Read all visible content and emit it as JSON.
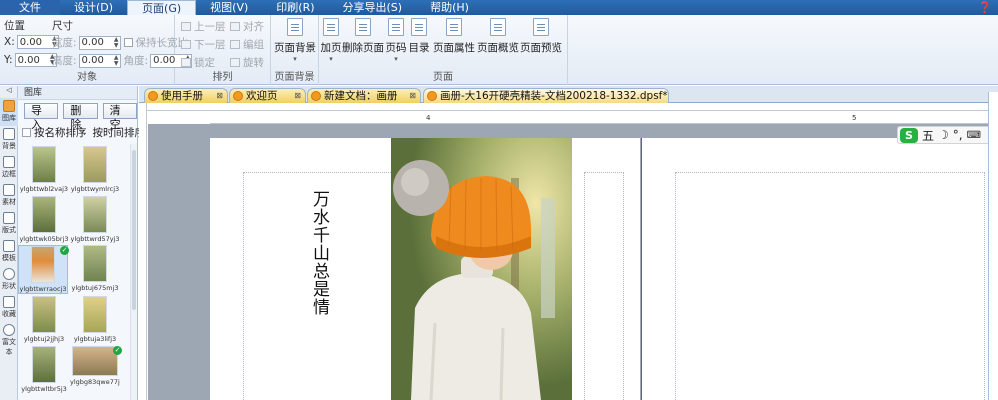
{
  "menu": {
    "items": [
      "文件(F)",
      "设计(D)",
      "页面(G)",
      "视图(V)",
      "印刷(R)",
      "分享导出(S)",
      "帮助(H)"
    ],
    "active_index": 2
  },
  "ribbon": {
    "position": {
      "header": "位置",
      "x_label": "X:",
      "x_value": "0.00",
      "y_label": "Y:",
      "y_value": "0.00"
    },
    "size": {
      "header": "尺寸",
      "width_label": "宽度:",
      "width_value": "0.00",
      "height_label": "高度:",
      "height_value": "0.00",
      "keep_ratio": "保持长宽比",
      "angle_label": "角度:",
      "angle_value": "0.00"
    },
    "object_group_label": "对象",
    "arrange": {
      "up": "上一层",
      "down": "下一层",
      "lock": "锁定",
      "align": "对齐",
      "group": "编组",
      "rotate": "旋转",
      "label": "排列"
    },
    "page_bg": {
      "label": "页面背景",
      "group_label": "页面背景"
    },
    "page_buttons": [
      "加页",
      "删除页面",
      "页码",
      "目录",
      "页面属性",
      "页面概览",
      "页面预览"
    ],
    "page_group_label": "页面"
  },
  "panel": {
    "title": "图库",
    "buttons": [
      "导入",
      "删除",
      "清空"
    ],
    "sort_by_name": "按名称排序",
    "sort_by_time": "按时间排序",
    "thumbs": [
      "ylgbttwbl2vaj3",
      "ylgbttwymlrcj3",
      "ylgbttwk05brj3",
      "ylgbttwrd57yj3",
      "ylgbttwrraocj3",
      "ylgbtuj675mj3",
      "ylgbtuj2jjhj3",
      "ylgbtuja3lifj3",
      "ylgbttwltbr5j3",
      "ylgbg83qwe77j3"
    ]
  },
  "left_tools": [
    "图库",
    "背景",
    "边框",
    "素材",
    "版式",
    "模板",
    "形状",
    "收藏",
    "富文本"
  ],
  "tabs": [
    "使用手册",
    "欢迎页",
    "新建文档：画册",
    "画册-大16开硬壳精装-文档200218-1332.dpsf*"
  ],
  "ruler_marks": [
    "4",
    "5"
  ],
  "page": {
    "vertical_text": "万水千山总是情"
  },
  "ime": {
    "label": "五"
  }
}
